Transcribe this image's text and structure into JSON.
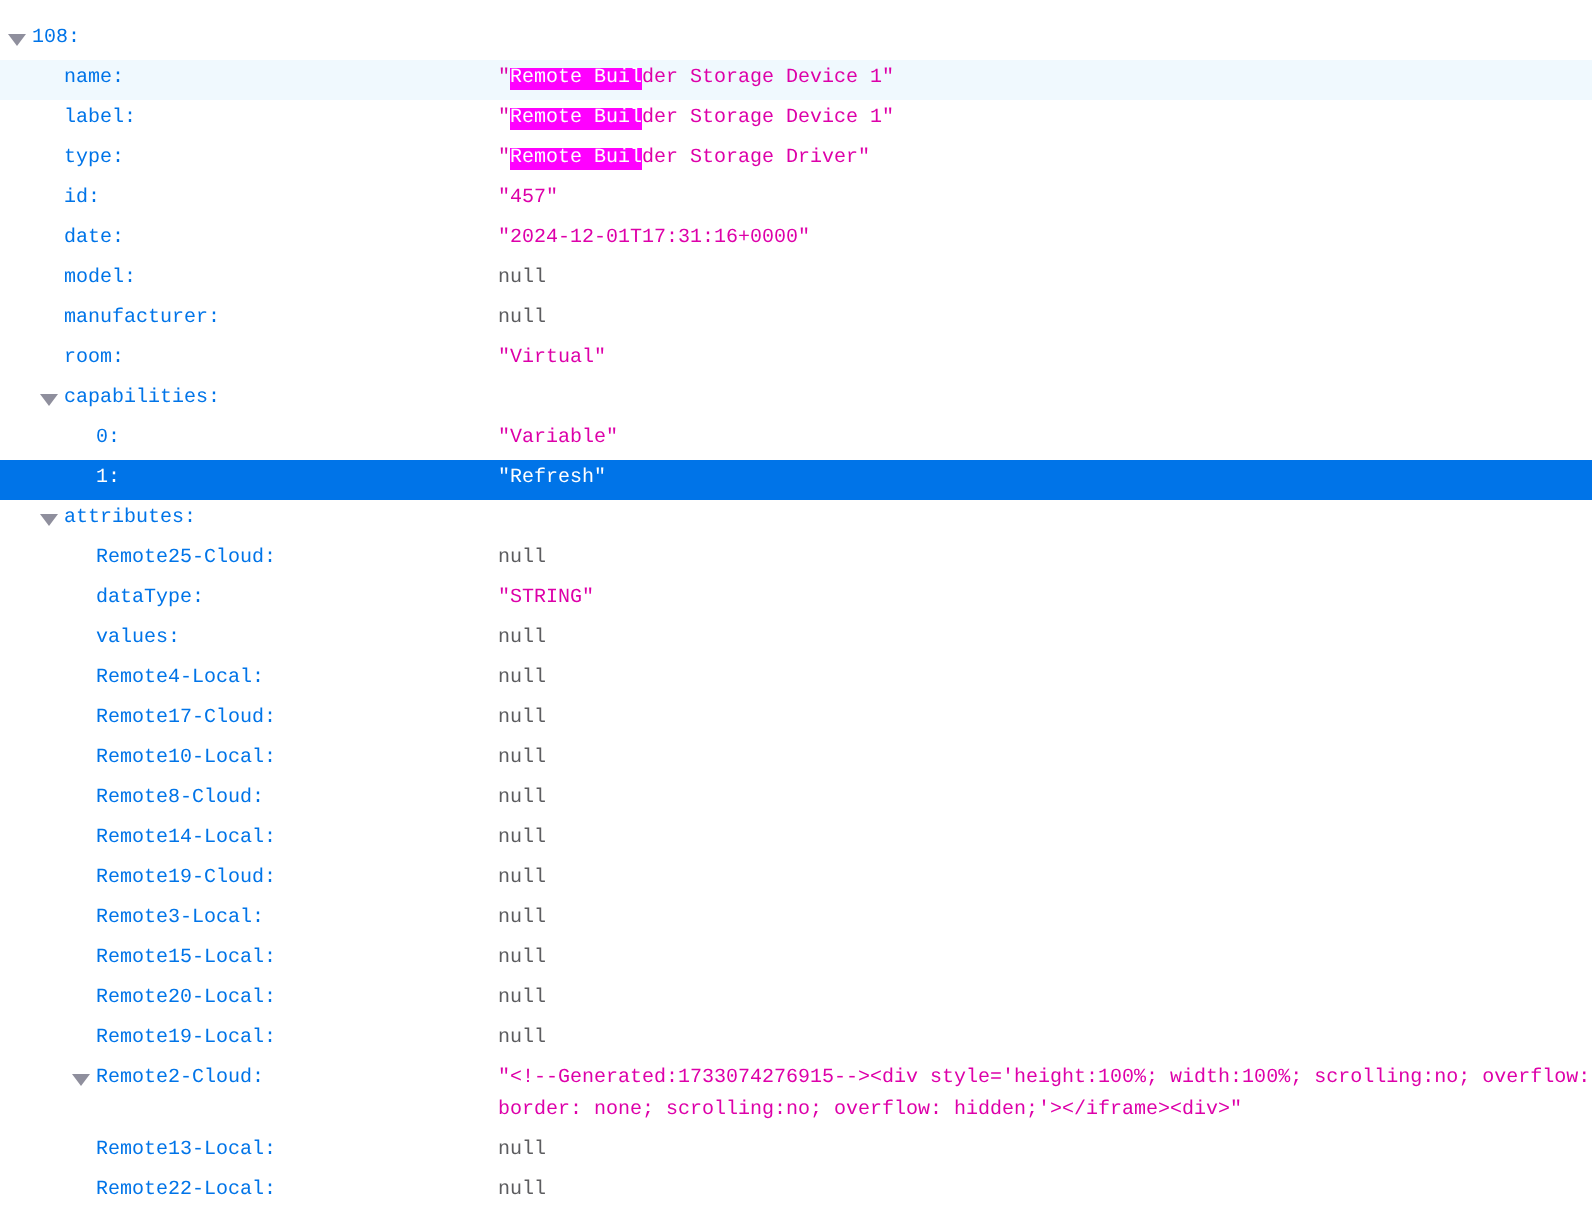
{
  "nodes": [
    {
      "key": "108:",
      "kind": "object",
      "expanded": true,
      "selected": false,
      "hovered": false,
      "children": [
        {
          "key": "name:",
          "kind": "string",
          "selected": false,
          "hovered": true,
          "value_parts": [
            {
              "text": "\"",
              "match": false
            },
            {
              "text": "Remote Buil",
              "match": true
            },
            {
              "text": "der Storage Device 1\"",
              "match": false
            }
          ]
        },
        {
          "key": "label:",
          "kind": "string",
          "selected": false,
          "hovered": false,
          "value_parts": [
            {
              "text": "\"",
              "match": false
            },
            {
              "text": "Remote Buil",
              "match": true
            },
            {
              "text": "der Storage Device 1\"",
              "match": false
            }
          ]
        },
        {
          "key": "type:",
          "kind": "string",
          "selected": false,
          "hovered": false,
          "value_parts": [
            {
              "text": "\"",
              "match": false
            },
            {
              "text": "Remote Buil",
              "match": true
            },
            {
              "text": "der Storage Driver\"",
              "match": false
            }
          ]
        },
        {
          "key": "id:",
          "kind": "string",
          "selected": false,
          "hovered": false,
          "value": "\"457\""
        },
        {
          "key": "date:",
          "kind": "string",
          "selected": false,
          "hovered": false,
          "value": "\"2024-12-01T17:31:16+0000\""
        },
        {
          "key": "model:",
          "kind": "null",
          "selected": false,
          "hovered": false,
          "value": "null"
        },
        {
          "key": "manufacturer:",
          "kind": "null",
          "selected": false,
          "hovered": false,
          "value": "null"
        },
        {
          "key": "room:",
          "kind": "string",
          "selected": false,
          "hovered": false,
          "value": "\"Virtual\""
        },
        {
          "key": "capabilities:",
          "kind": "object",
          "expanded": true,
          "selected": false,
          "hovered": false,
          "children": [
            {
              "key": "0:",
              "kind": "string",
              "selected": false,
              "hovered": false,
              "value": "\"Variable\""
            },
            {
              "key": "1:",
              "kind": "string",
              "selected": true,
              "hovered": false,
              "value": "\"Refresh\""
            }
          ]
        },
        {
          "key": "attributes:",
          "kind": "object",
          "expanded": true,
          "selected": false,
          "hovered": false,
          "children": [
            {
              "key": "Remote25-Cloud:",
              "kind": "null",
              "selected": false,
              "hovered": false,
              "value": "null"
            },
            {
              "key": "dataType:",
              "kind": "string",
              "selected": false,
              "hovered": false,
              "value": "\"STRING\""
            },
            {
              "key": "values:",
              "kind": "null",
              "selected": false,
              "hovered": false,
              "value": "null"
            },
            {
              "key": "Remote4-Local:",
              "kind": "null",
              "selected": false,
              "hovered": false,
              "value": "null"
            },
            {
              "key": "Remote17-Cloud:",
              "kind": "null",
              "selected": false,
              "hovered": false,
              "value": "null"
            },
            {
              "key": "Remote10-Local:",
              "kind": "null",
              "selected": false,
              "hovered": false,
              "value": "null"
            },
            {
              "key": "Remote8-Cloud:",
              "kind": "null",
              "selected": false,
              "hovered": false,
              "value": "null"
            },
            {
              "key": "Remote14-Local:",
              "kind": "null",
              "selected": false,
              "hovered": false,
              "value": "null"
            },
            {
              "key": "Remote19-Cloud:",
              "kind": "null",
              "selected": false,
              "hovered": false,
              "value": "null"
            },
            {
              "key": "Remote3-Local:",
              "kind": "null",
              "selected": false,
              "hovered": false,
              "value": "null"
            },
            {
              "key": "Remote15-Local:",
              "kind": "null",
              "selected": false,
              "hovered": false,
              "value": "null"
            },
            {
              "key": "Remote20-Local:",
              "kind": "null",
              "selected": false,
              "hovered": false,
              "value": "null"
            },
            {
              "key": "Remote19-Local:",
              "kind": "null",
              "selected": false,
              "hovered": false,
              "value": "null"
            },
            {
              "key": "Remote2-Cloud:",
              "kind": "string",
              "expanded": true,
              "selected": false,
              "hovered": false,
              "value_lines": [
                "\"<!--Generated:1733074276915--><div style='height:100%; width:100%; scrolling:no; overflow:",
                "border: none; scrolling:no; overflow: hidden;'></iframe><div>\""
              ]
            },
            {
              "key": "Remote13-Local:",
              "kind": "null",
              "selected": false,
              "hovered": false,
              "value": "null"
            },
            {
              "key": "Remote22-Local:",
              "kind": "null",
              "selected": false,
              "hovered": false,
              "value": "null"
            }
          ]
        }
      ]
    }
  ]
}
